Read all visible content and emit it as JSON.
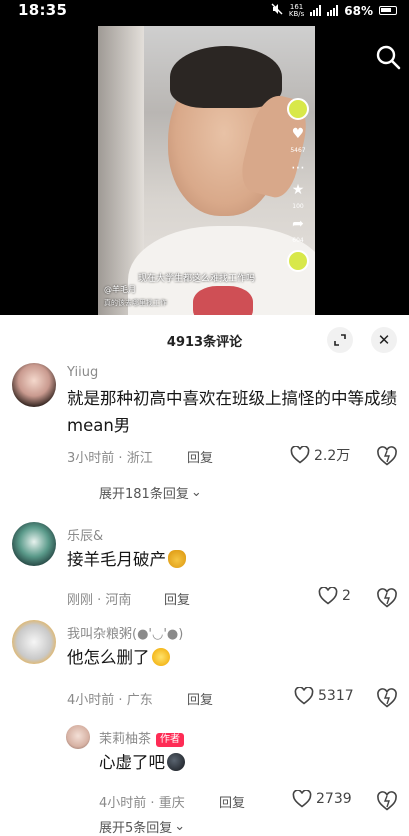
{
  "status_bar": {
    "time": "18:35",
    "network_speed": "161",
    "network_unit": "KB/s",
    "battery": "68%"
  },
  "video": {
    "caption": "现在大学生都这么难找工作吗",
    "author": "@羊毛月",
    "subtext": "真的该去哪里找工作",
    "likes": "5467",
    "stars": "100",
    "shares": "604"
  },
  "comments_panel": {
    "title": "4913条评论",
    "comments": [
      {
        "username": "Yiiug",
        "text": "就是那种初高中喜欢在班级上搞怪的中等成绩mean男",
        "time": "3小时前",
        "location": "浙江",
        "reply_label": "回复",
        "likes": "2.2万",
        "expand_label": "展开181条回复"
      },
      {
        "username": "乐辰&",
        "text": "接羊毛月破产",
        "time": "刚刚",
        "location": "河南",
        "reply_label": "回复",
        "likes": "2"
      },
      {
        "username": "我叫杂粮粥(●'◡'●)",
        "text": "他怎么删了",
        "time": "4小时前",
        "location": "广东",
        "reply_label": "回复",
        "likes": "5317",
        "reply": {
          "username": "茉莉柚茶",
          "badge": "作者",
          "text": "心虚了吧",
          "time": "4小时前",
          "location": "重庆",
          "reply_label": "回复",
          "likes": "2739"
        },
        "expand_label": "展开5条回复"
      }
    ]
  },
  "colors": {
    "badge": "#fe2c55",
    "meta_text": "#8a8a8a",
    "body_text": "#161616"
  }
}
